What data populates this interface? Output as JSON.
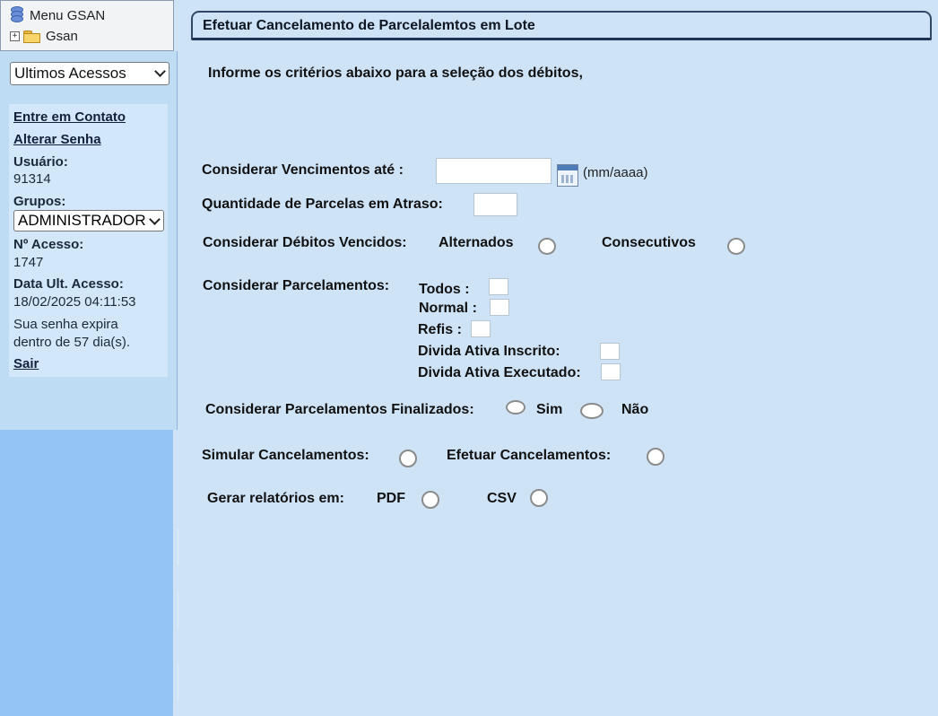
{
  "menu": {
    "root_label": "Menu GSAN",
    "folder_label": "Gsan",
    "expand_symbol": "+"
  },
  "sidebar": {
    "recent_select_value": "Ultimos Acessos",
    "contact_link": "Entre em Contato",
    "change_password_link": "Alterar Senha",
    "user_label": "Usuário:",
    "user_value": "91314",
    "groups_label": "Grupos:",
    "groups_value": "ADMINISTRADOR",
    "access_count_label": "Nº Acesso:",
    "access_count_value": "1747",
    "last_access_label": "Data Ult. Acesso:",
    "last_access_value": "18/02/2025 04:11:53",
    "expiry_line1": "Sua senha expira",
    "expiry_line2": "dentro de 57 dia(s).",
    "logout_link": "Sair"
  },
  "form": {
    "title": "Efetuar Cancelamento de Parcelalemtos em Lote",
    "intro": "Informe os critérios abaixo para a seleção dos débitos,",
    "due_date_label": "Considerar Vencimentos até :",
    "due_date_value": "",
    "date_format_hint": "(mm/aaaa)",
    "overdue_qty_label": "Quantidade de Parcelas em Atraso:",
    "overdue_qty_value": "",
    "overdue_debts_label": "Considerar Débitos Vencidos:",
    "alternated_label": "Alternados",
    "consecutive_label": "Consecutivos",
    "installments_label": "Considerar Parcelamentos:",
    "all_label": "Todos :",
    "normal_label": "Normal :",
    "refis_label": "Refis :",
    "active_debt_registered_label": "Divida Ativa Inscrito:",
    "active_debt_executed_label": "Divida Ativa Executado:",
    "finished_installments_label": "Considerar Parcelamentos Finalizados:",
    "yes_label": "Sim",
    "no_label": "Não",
    "simulate_label": "Simular Cancelamentos:",
    "execute_label": "Efetuar Cancelamentos:",
    "report_label": "Gerar relatórios em:",
    "pdf_label": "PDF",
    "csv_label": "CSV"
  }
}
